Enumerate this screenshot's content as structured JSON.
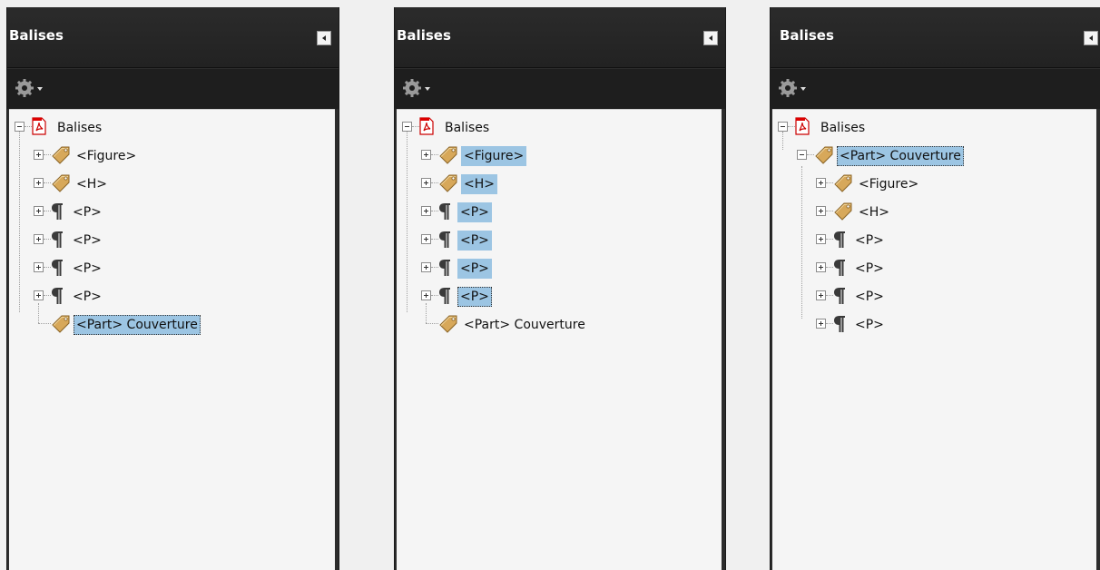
{
  "panel_title": "Balises",
  "colors": {
    "panel_dark": "#2c2c2c",
    "tree_bg": "#f5f5f5",
    "selection": "#9cc5e3"
  },
  "icons": {
    "options": "gear-icon",
    "collapse": "triangle-left-icon",
    "pdf": "pdf-icon",
    "tag": "tag-icon",
    "paragraph": "pilcrow-icon"
  },
  "panels": [
    {
      "root": {
        "label": "Balises",
        "expanded": true
      },
      "items": [
        {
          "label": "<Figure>",
          "icon": "tag",
          "expandable": true,
          "selected": false
        },
        {
          "label": "<H>",
          "icon": "tag",
          "expandable": true,
          "selected": false
        },
        {
          "label": "<P>",
          "icon": "paragraph",
          "expandable": true,
          "selected": false
        },
        {
          "label": "<P>",
          "icon": "paragraph",
          "expandable": true,
          "selected": false
        },
        {
          "label": "<P>",
          "icon": "paragraph",
          "expandable": true,
          "selected": false
        },
        {
          "label": "<P>",
          "icon": "paragraph",
          "expandable": true,
          "selected": false
        },
        {
          "label": "<Part> Couverture",
          "icon": "tag",
          "expandable": false,
          "selected": true
        }
      ]
    },
    {
      "root": {
        "label": "Balises",
        "expanded": true
      },
      "items": [
        {
          "label": "<Figure>",
          "icon": "tag",
          "expandable": true,
          "selected": true
        },
        {
          "label": "<H>",
          "icon": "tag",
          "expandable": true,
          "selected": true
        },
        {
          "label": "<P>",
          "icon": "paragraph",
          "expandable": true,
          "selected": true
        },
        {
          "label": "<P>",
          "icon": "paragraph",
          "expandable": true,
          "selected": true
        },
        {
          "label": "<P>",
          "icon": "paragraph",
          "expandable": true,
          "selected": true
        },
        {
          "label": "<P>",
          "icon": "paragraph",
          "expandable": true,
          "selected": true
        },
        {
          "label": "<Part> Couverture",
          "icon": "tag",
          "expandable": false,
          "selected": false
        }
      ]
    },
    {
      "root": {
        "label": "Balises",
        "expanded": true
      },
      "parent": {
        "label": "<Part> Couverture",
        "icon": "tag",
        "expanded": true,
        "selected": true
      },
      "items": [
        {
          "label": "<Figure>",
          "icon": "tag",
          "expandable": true,
          "selected": false
        },
        {
          "label": "<H>",
          "icon": "tag",
          "expandable": true,
          "selected": false
        },
        {
          "label": "<P>",
          "icon": "paragraph",
          "expandable": true,
          "selected": false
        },
        {
          "label": "<P>",
          "icon": "paragraph",
          "expandable": true,
          "selected": false
        },
        {
          "label": "<P>",
          "icon": "paragraph",
          "expandable": true,
          "selected": false
        },
        {
          "label": "<P>",
          "icon": "paragraph",
          "expandable": true,
          "selected": false
        }
      ]
    }
  ]
}
